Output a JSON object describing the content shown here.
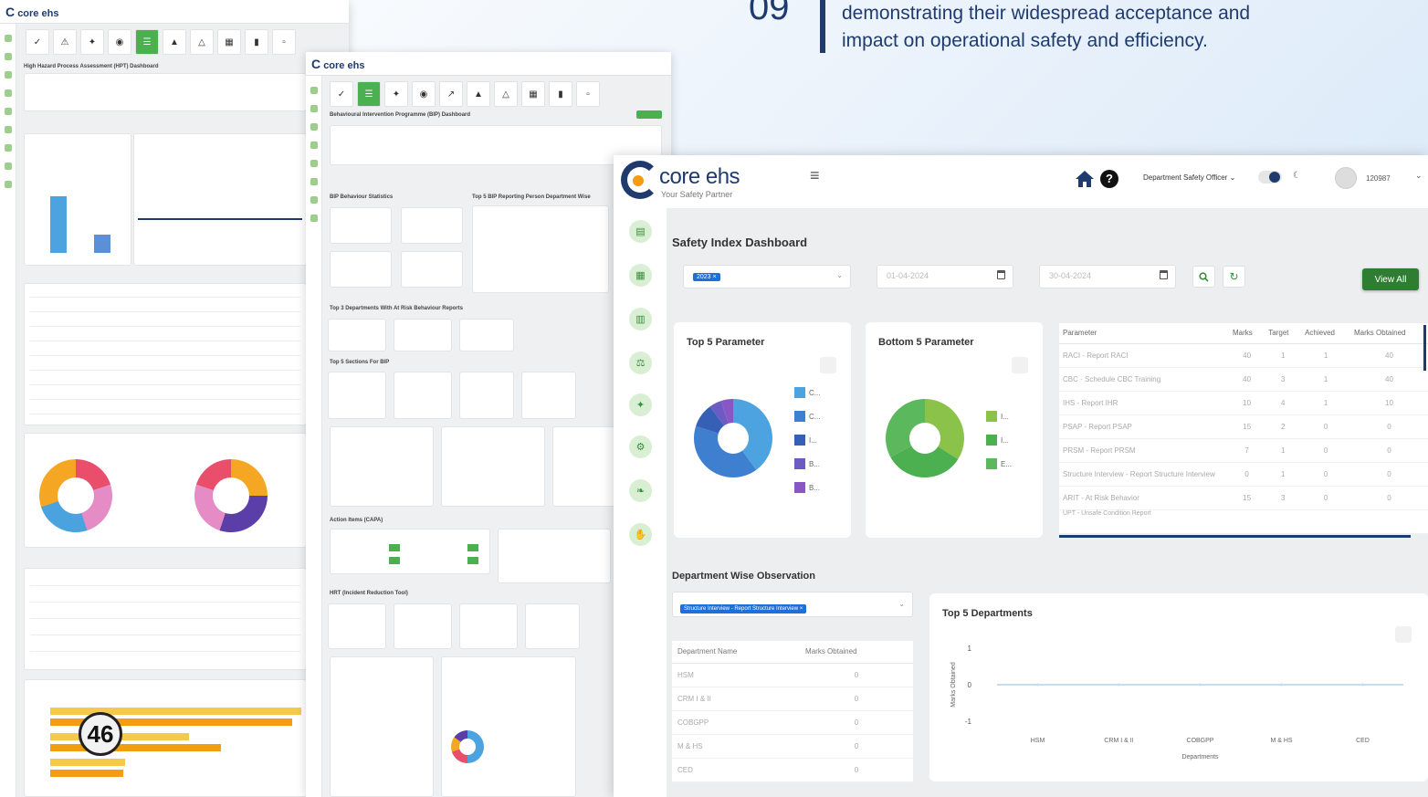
{
  "page": {
    "number": "09",
    "quote_line1": "demonstrating their widespread acceptance and",
    "quote_line2": "impact on operational safety and efficiency.",
    "badge": "46"
  },
  "bg_shots": {
    "logo": "core ehs",
    "shot1_title": "High Hazard Process Assessment (HPT) Dashboard",
    "shot2_title": "Behavioural Intervention Programme (BIP) Dashboard",
    "shot2_sections": [
      "BIP Behaviour Statistics",
      "Top 5 BIP Reporting Person Department Wise",
      "Top 3 Departments With At Risk Behaviour Reports",
      "Top 5 Sections For BIP",
      "Action Items (CAPA)",
      "HRT (Incident Reduction Tool)"
    ],
    "colors": {
      "accent": "#4caf50",
      "brand": "#1f3b6e"
    }
  },
  "header": {
    "logo_name": "core ehs",
    "logo_tagline": "Your Safety Partner",
    "role": "Department Safety Officer",
    "username": "120987"
  },
  "sidebar": [
    "clipboard-icon",
    "list-icon",
    "chart-icon",
    "scale-icon",
    "bulb-icon",
    "gear-icon",
    "leaf-icon",
    "hand-icon"
  ],
  "dashboard": {
    "title": "Safety Index Dashboard",
    "year_chip": "2023 ×",
    "date_from": "01-04-2024",
    "date_to": "30-04-2024",
    "view_all": "View All",
    "top5_title": "Top 5 Parameter",
    "bottom5_title": "Bottom 5 Parameter",
    "top5_legend": [
      "C...",
      "C...",
      "I...",
      "B...",
      "B..."
    ],
    "bottom5_legend": [
      "I...",
      "I...",
      "E..."
    ]
  },
  "param_table": {
    "columns": [
      "Parameter",
      "Marks",
      "Target",
      "Achieved",
      "Marks Obtained"
    ],
    "rows": [
      [
        "RACI - Report RACI",
        "40",
        "1",
        "1",
        "40"
      ],
      [
        "CBC - Schedule CBC Training",
        "40",
        "3",
        "1",
        "40"
      ],
      [
        "IHS - Report IHR",
        "10",
        "4",
        "1",
        "10"
      ],
      [
        "PSAP - Report PSAP",
        "15",
        "2",
        "0",
        "0"
      ],
      [
        "PRSM - Report PRSM",
        "7",
        "1",
        "0",
        "0"
      ],
      [
        "Structure Interview - Report Structure Interview",
        "0",
        "1",
        "0",
        "0"
      ],
      [
        "ARIT - At Risk Behavior",
        "15",
        "3",
        "0",
        "0"
      ],
      [
        "UPT - Unsafe Condition Report",
        "",
        "",
        "",
        ""
      ]
    ]
  },
  "department": {
    "section_title": "Department Wise Observation",
    "selected_chip": "Structure Interview - Report Structure Interview ×",
    "table_columns": [
      "Department Name",
      "Marks Obtained"
    ],
    "rows": [
      [
        "HSM",
        "0"
      ],
      [
        "CRM I & II",
        "0"
      ],
      [
        "COBGPP",
        "0"
      ],
      [
        "M & HS",
        "0"
      ],
      [
        "CED",
        "0"
      ]
    ]
  },
  "chart_data": [
    {
      "type": "pie",
      "title": "Top 5 Parameter",
      "labels": [
        "C...",
        "C...",
        "I...",
        "B...",
        "B..."
      ],
      "values": [
        40,
        40,
        10,
        5,
        5
      ],
      "colors": [
        "#4da3e0",
        "#3f7fd0",
        "#3560b5",
        "#6d5bc4",
        "#8a56c4"
      ]
    },
    {
      "type": "pie",
      "title": "Bottom 5 Parameter",
      "labels": [
        "I...",
        "I...",
        "E..."
      ],
      "values": [
        34,
        33,
        33
      ],
      "colors": [
        "#8bc34a",
        "#4caf50",
        "#5cb85c"
      ]
    },
    {
      "type": "line",
      "title": "Top 5 Departments",
      "categories": [
        "HSM",
        "CRM I & II",
        "COBGPP",
        "M & HS",
        "CED"
      ],
      "series": [
        {
          "values": [
            0,
            0,
            0,
            0,
            0
          ]
        }
      ],
      "ylim": [
        -1,
        1
      ],
      "yticks": [
        "1",
        "0",
        "-1"
      ],
      "xlabel": "Departments",
      "ylabel": "Marks Obtained",
      "color": "#c8dcef"
    }
  ]
}
